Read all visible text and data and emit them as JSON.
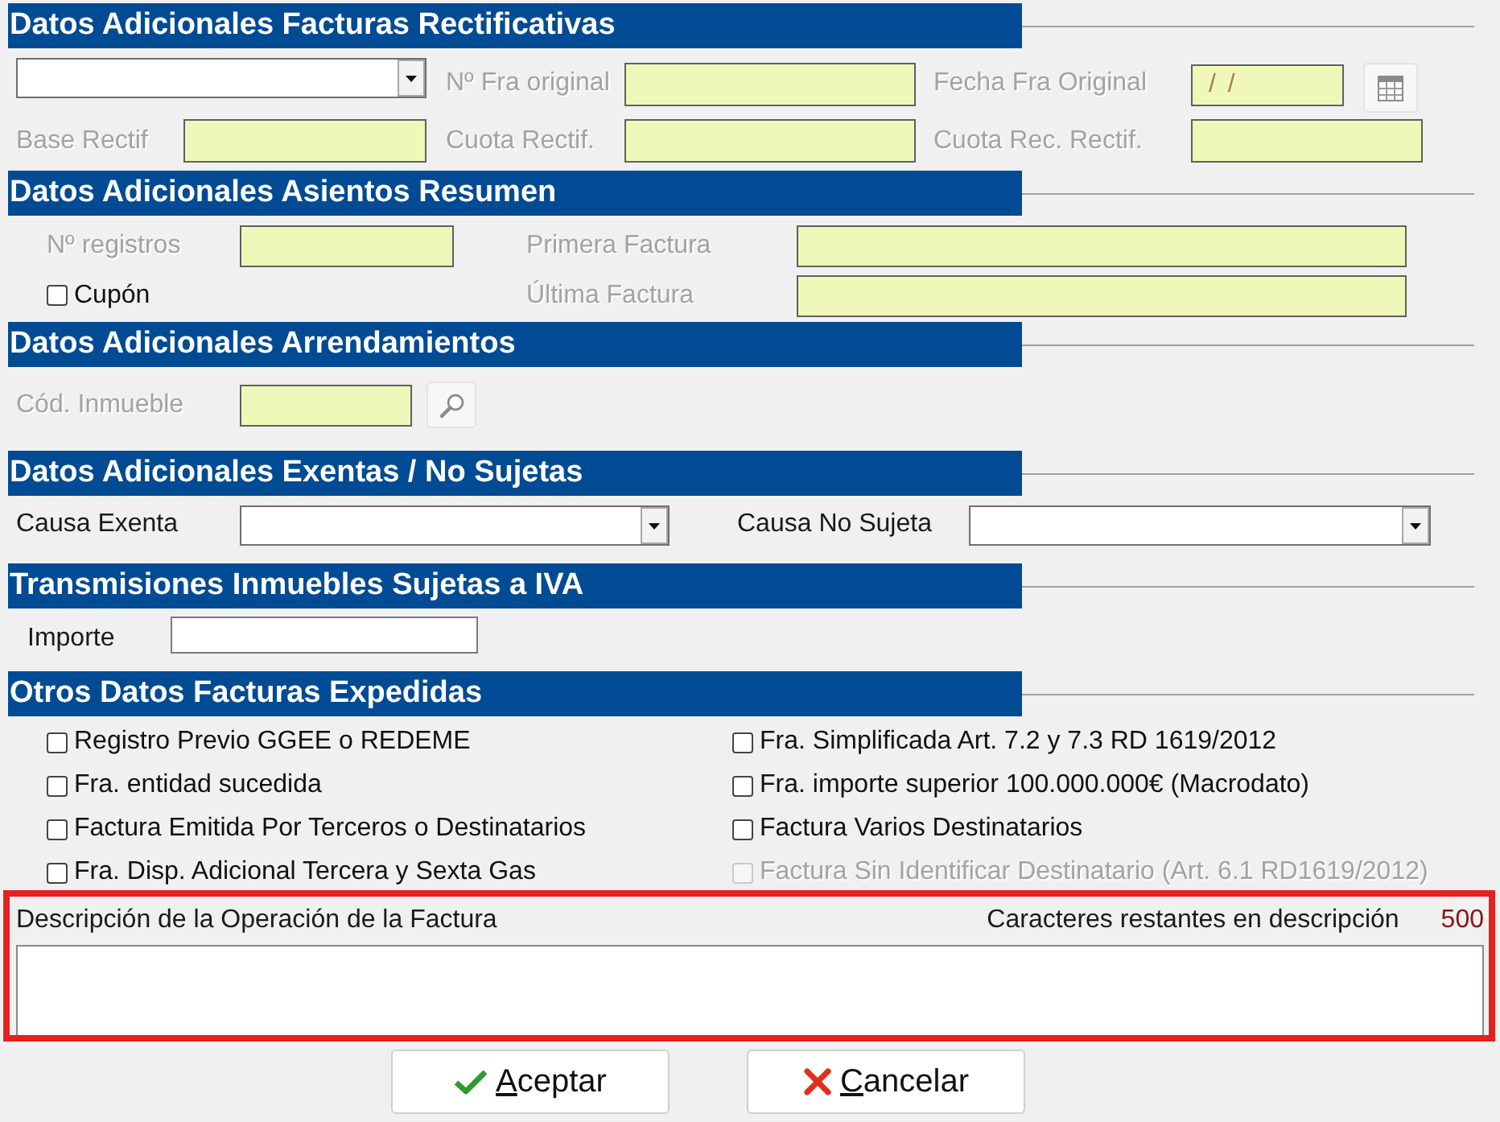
{
  "sections": [
    {
      "title": "Datos Adicionales Facturas Rectificativas",
      "rows": [
        [
          {
            "kind": "select",
            "disabled": false
          },
          {
            "kind": "field",
            "label": "Nº Fra original",
            "disabled": true
          },
          {
            "kind": "date",
            "label": "Fecha Fra Original",
            "value": "/ /",
            "disabled": true
          }
        ],
        [
          {
            "kind": "field",
            "label": "Base Rectif",
            "disabled": true
          },
          {
            "kind": "field",
            "label": "Cuota Rectif.",
            "disabled": true
          },
          {
            "kind": "field",
            "label": "Cuota Rec. Rectif.",
            "disabled": true
          }
        ]
      ]
    },
    {
      "title": "Datos Adicionales Asientos Resumen",
      "rows": [
        [
          {
            "kind": "field",
            "label": "Nº registros",
            "disabled": true
          },
          {
            "kind": "field",
            "label": "Primera Factura",
            "disabled": true
          }
        ],
        [
          {
            "kind": "checkbox",
            "label": "Cupón",
            "checked": false,
            "disabled": false
          },
          {
            "kind": "field",
            "label": "Última Factura",
            "disabled": true
          }
        ]
      ]
    },
    {
      "title": "Datos Adicionales Arrendamientos",
      "rows": [
        [
          {
            "kind": "lookup",
            "label": "Cód. Inmueble",
            "disabled": true
          }
        ]
      ]
    },
    {
      "title": "Datos Adicionales Exentas / No Sujetas",
      "rows": [
        [
          {
            "kind": "select",
            "label": "Causa Exenta",
            "disabled": false
          },
          {
            "kind": "select",
            "label": "Causa No Sujeta",
            "disabled": false
          }
        ]
      ]
    },
    {
      "title": "Transmisiones Inmuebles Sujetas a IVA",
      "rows": [
        [
          {
            "kind": "field",
            "label": "Importe",
            "disabled": false
          }
        ]
      ]
    },
    {
      "title": "Otros Datos Facturas Expedidas",
      "rows": [
        [
          {
            "kind": "checkbox",
            "label": "Registro Previo GGEE o REDEME",
            "checked": false,
            "disabled": false
          },
          {
            "kind": "checkbox",
            "label": "Fra. Simplificada Art. 7.2 y 7.3 RD 1619/2012",
            "checked": false,
            "disabled": false
          }
        ],
        [
          {
            "kind": "checkbox",
            "label": "Fra. entidad sucedida",
            "checked": false,
            "disabled": false
          },
          {
            "kind": "checkbox",
            "label": "Fra. importe superior 100.000.000€ (Macrodato)",
            "checked": false,
            "disabled": false
          }
        ],
        [
          {
            "kind": "checkbox",
            "label": "Factura Emitida Por Terceros o Destinatarios",
            "checked": false,
            "disabled": false
          },
          {
            "kind": "checkbox",
            "label": "Factura Varios Destinatarios",
            "checked": false,
            "disabled": false
          }
        ],
        [
          {
            "kind": "checkbox",
            "label": "Fra. Disp. Adicional Tercera y Sexta Gas",
            "checked": false,
            "disabled": false
          },
          {
            "kind": "checkbox",
            "label": "Factura Sin Identificar Destinatario (Art. 6.1 RD1619/2012)",
            "checked": false,
            "disabled": true
          }
        ]
      ]
    }
  ],
  "description": {
    "label": "Descripción de la Operación de la Factura",
    "counter_label": "Caracteres restantes en descripción",
    "counter": "500",
    "highlighted": true
  },
  "buttons": [
    {
      "kind": "ok",
      "label": "Aceptar"
    },
    {
      "kind": "cancel",
      "label": "Cancelar"
    }
  ]
}
